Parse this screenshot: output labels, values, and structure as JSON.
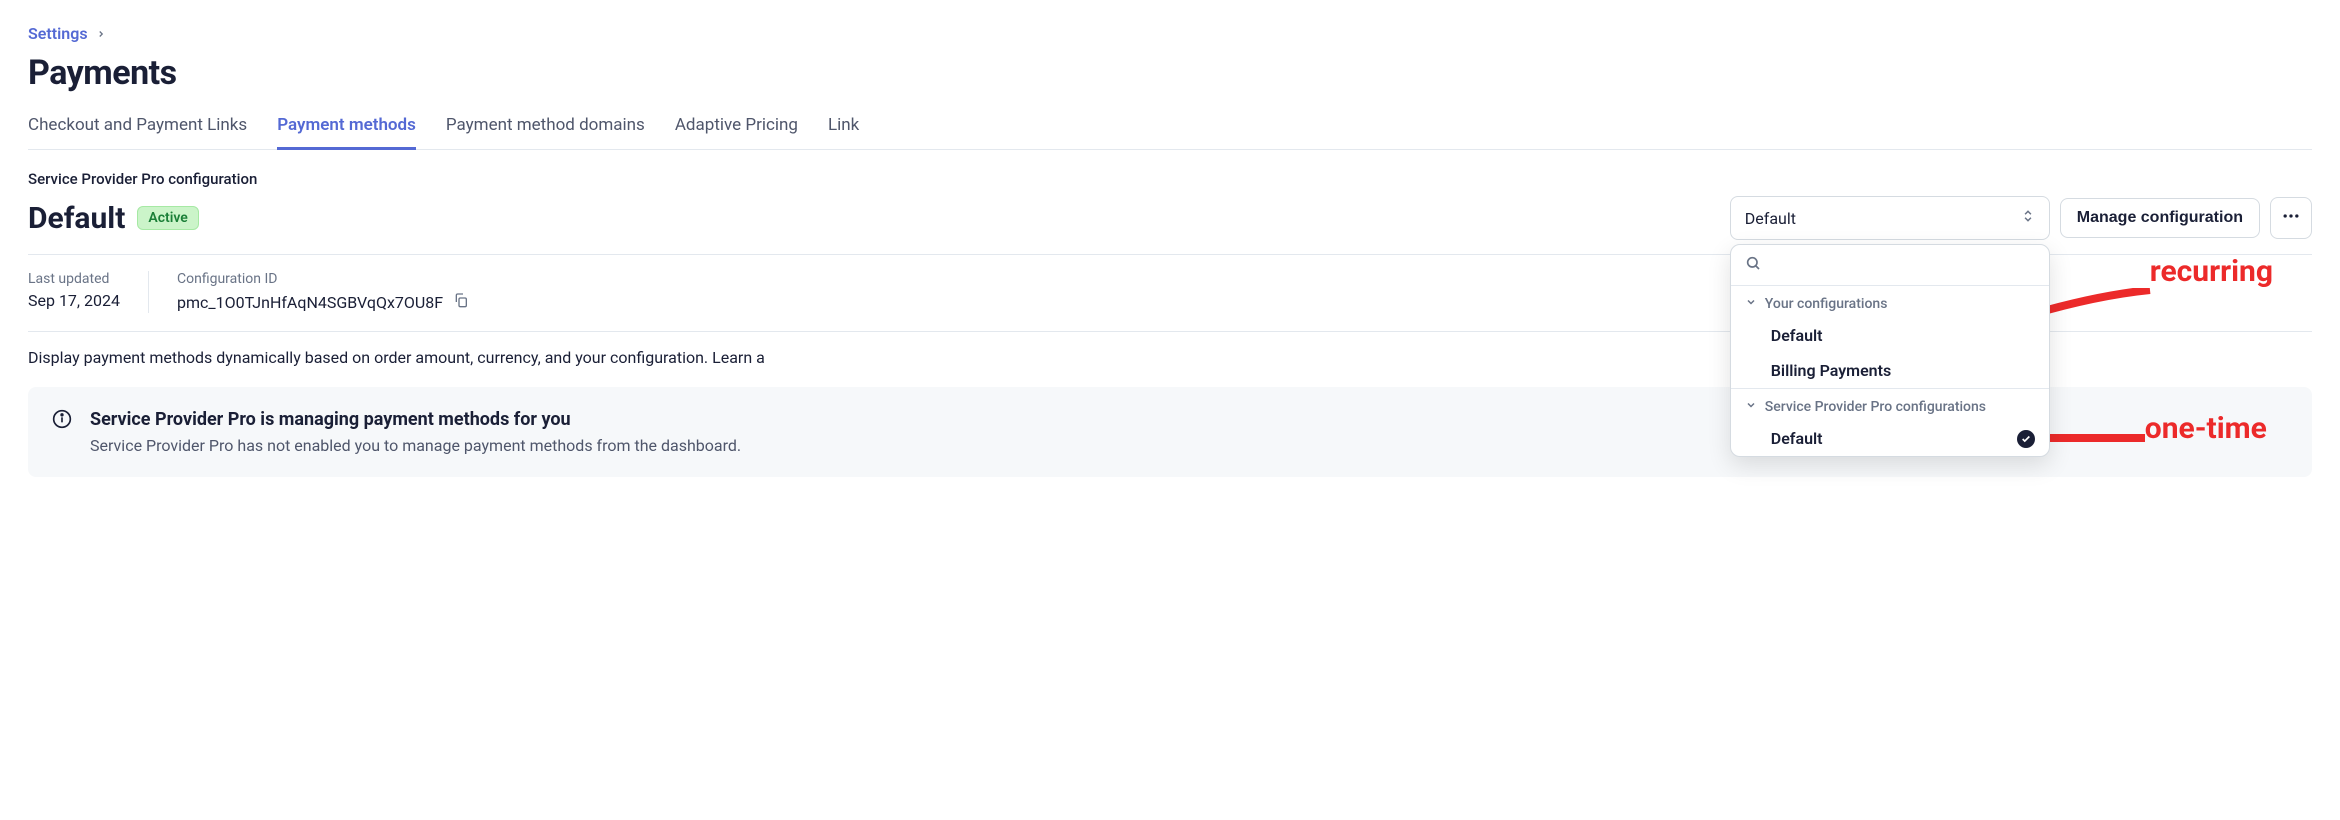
{
  "breadcrumb": {
    "label": "Settings"
  },
  "page_title": "Payments",
  "tabs": [
    {
      "label": "Checkout and Payment Links",
      "active": false
    },
    {
      "label": "Payment methods",
      "active": true
    },
    {
      "label": "Payment method domains",
      "active": false
    },
    {
      "label": "Adaptive Pricing",
      "active": false
    },
    {
      "label": "Link",
      "active": false
    }
  ],
  "config": {
    "section_label": "Service Provider Pro configuration",
    "title": "Default",
    "badge": "Active",
    "select_value": "Default",
    "manage_button": "Manage configuration",
    "last_updated_label": "Last updated",
    "last_updated_value": "Sep 17, 2024",
    "config_id_label": "Configuration ID",
    "config_id_value": "pmc_1O0TJnHfAqN4SGBVqQx7OU8F"
  },
  "description": "Display payment methods dynamically based on order amount, currency, and your configuration. Learn a",
  "info_panel": {
    "title": "Service Provider Pro is managing payment methods for you",
    "subtitle": "Service Provider Pro has not enabled you to manage payment methods from the dashboard."
  },
  "dropdown": {
    "search_placeholder": "",
    "groups": [
      {
        "header": "Your configurations",
        "items": [
          {
            "label": "Default",
            "selected": false
          },
          {
            "label": "Billing Payments",
            "selected": false
          }
        ]
      },
      {
        "header": "Service Provider Pro configurations",
        "items": [
          {
            "label": "Default",
            "selected": true
          }
        ]
      }
    ]
  },
  "annotations": {
    "recurring": "recurring",
    "one_time": "one-time"
  }
}
